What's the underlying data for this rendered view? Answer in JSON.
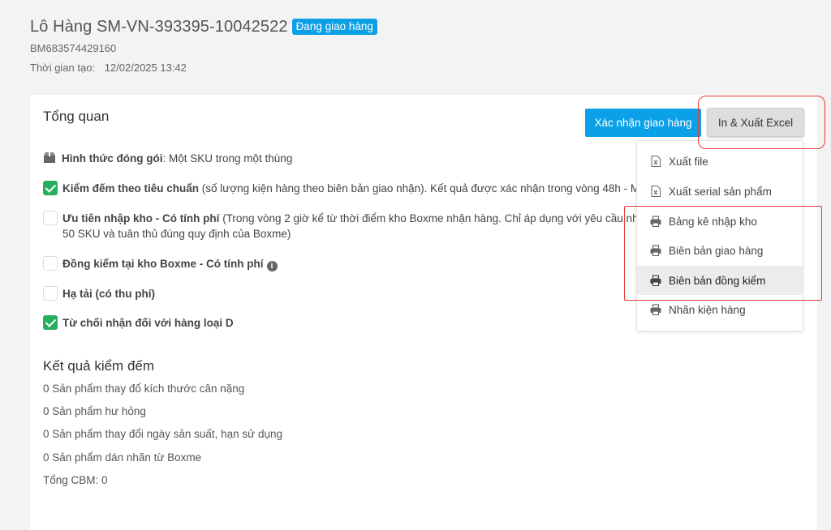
{
  "header": {
    "title": "Lô Hàng SM-VN-393395-10042522",
    "status_badge": "Đang giao hàng",
    "code": "BM683574429160",
    "created_label": "Thời gian tạo:",
    "created_value": "12/02/2025 13:42"
  },
  "overview": {
    "title": "Tổng quan",
    "confirm_button": "Xác nhận giao hàng",
    "export_button": "In & Xuất Excel",
    "packaging": {
      "label": "Hình thức đóng gói",
      "value": ": Một SKU trong một thùng"
    },
    "options": [
      {
        "bold": "Kiểm đếm theo tiêu chuẩn",
        "rest": " (số lượng kiện hàng theo biên bản giao nhận). Kết quả được xác nhận trong vòng 48h - Miễn",
        "checked": true
      },
      {
        "bold": "Ưu tiên nhập kho - Có tính phí",
        "rest": " (Trong vòng 2 giờ kể từ thời điểm kho Boxme nhận hàng. Chỉ áp dụng với yêu cầu nhập kh",
        "rest2": "50 SKU và tuân thủ đúng quy định của Boxme)",
        "checked": false
      },
      {
        "bold": "Đồng kiểm tại kho Boxme - Có tính phí",
        "rest": "",
        "checked": false
      },
      {
        "bold": "Hạ tải (có thu phí)",
        "rest": "",
        "checked": false
      },
      {
        "bold": "Từ chối nhận đối với hàng loại D",
        "rest": "",
        "checked": true
      }
    ]
  },
  "results": {
    "title": "Kết quả kiểm đếm",
    "lines": [
      "0 Sản phẩm thay đổ kích thước cân nặng",
      "0 Sản phẩm hư hỏng",
      "0 Sản phẩm thay đổi ngày sản suất, hạn sử dụng",
      "0 Sản phẩm dán nhãn từ Boxme",
      "Tổng CBM: 0"
    ]
  },
  "dropdown": {
    "items": [
      {
        "label": "Xuất file",
        "icon": "excel-file-icon"
      },
      {
        "label": "Xuất serial sản phẩm",
        "icon": "excel-file-icon"
      },
      {
        "label": "Bảng kê nhập kho",
        "icon": "printer-icon"
      },
      {
        "label": "Biên bản giao hàng",
        "icon": "printer-icon"
      },
      {
        "label": "Biên bản đồng kiểm",
        "icon": "printer-icon",
        "active": true
      },
      {
        "label": "Nhãn kiện hàng",
        "icon": "printer-icon"
      }
    ]
  },
  "colors": {
    "accent": "#0aa1e8",
    "check": "#27ae60",
    "highlight": "#e53935"
  }
}
